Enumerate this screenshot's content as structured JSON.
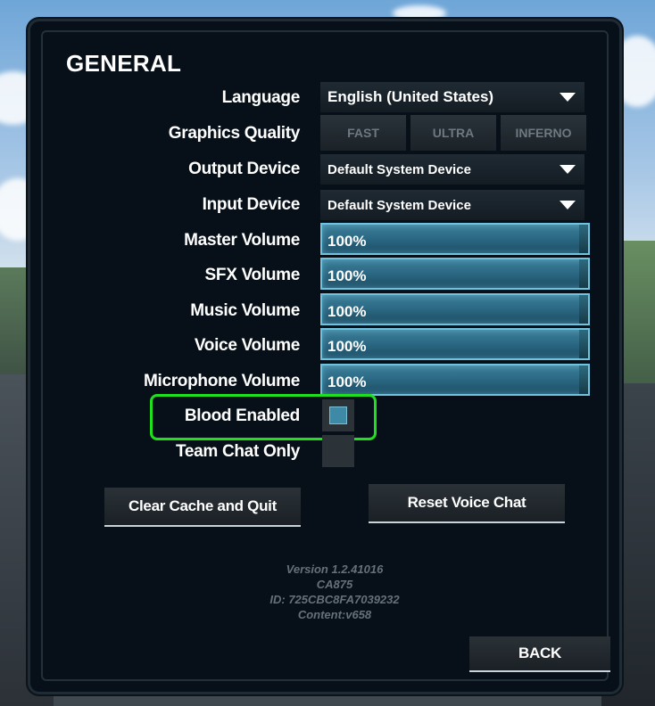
{
  "title": "GENERAL",
  "settings": {
    "language": {
      "label": "Language",
      "value": "English (United States)"
    },
    "graphics": {
      "label": "Graphics Quality",
      "options": [
        "FAST",
        "ULTRA",
        "INFERNO"
      ]
    },
    "output_device": {
      "label": "Output Device",
      "value": "Default System Device"
    },
    "input_device": {
      "label": "Input Device",
      "value": "Default System Device"
    },
    "master_volume": {
      "label": "Master Volume",
      "value": "100%"
    },
    "sfx_volume": {
      "label": "SFX Volume",
      "value": "100%"
    },
    "music_volume": {
      "label": "Music Volume",
      "value": "100%"
    },
    "voice_volume": {
      "label": "Voice Volume",
      "value": "100%"
    },
    "mic_volume": {
      "label": "Microphone Volume",
      "value": "100%"
    },
    "blood_enabled": {
      "label": "Blood Enabled",
      "checked": true
    },
    "team_chat_only": {
      "label": "Team Chat Only",
      "checked": false
    }
  },
  "buttons": {
    "clear_cache": "Clear Cache and Quit",
    "reset_voice": "Reset Voice Chat",
    "back": "BACK"
  },
  "version_info": {
    "version": "Version 1.2.41016",
    "build": "CA875",
    "id": "ID: 725CBC8FA7039232",
    "content": "Content:v658"
  },
  "colors": {
    "panel_bg": "#071018",
    "slider_fill": "#2c6a85",
    "slider_border": "#6fc3de",
    "highlight": "#1fe01f"
  }
}
